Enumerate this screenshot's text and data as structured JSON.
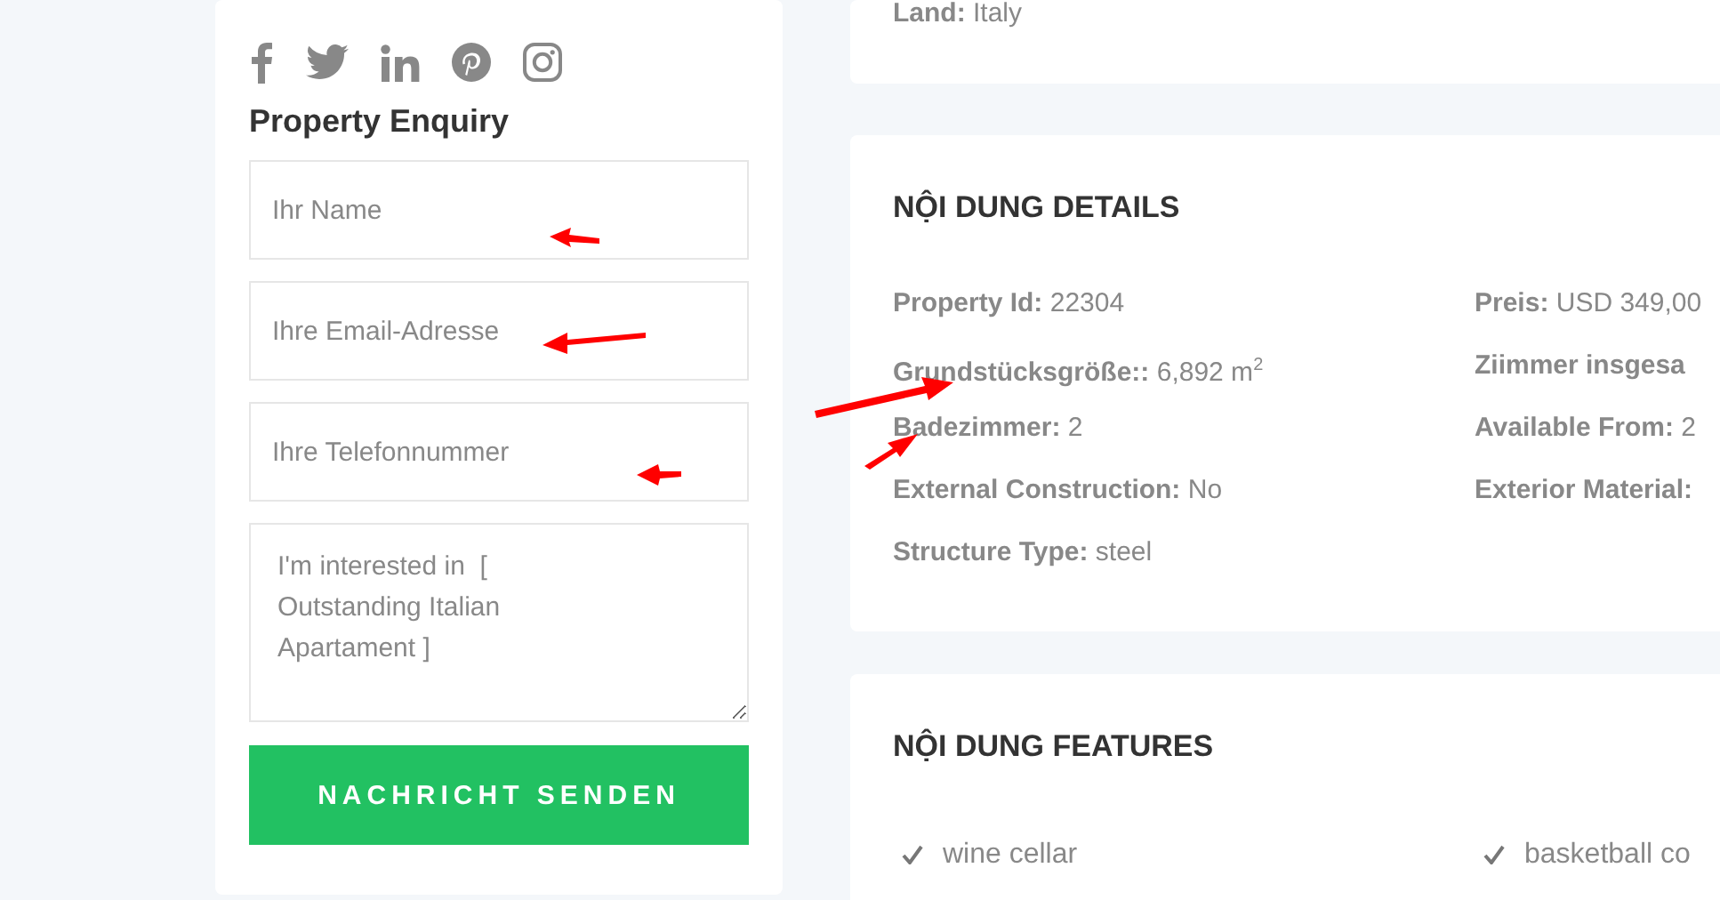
{
  "enquiry": {
    "title": "Property Enquiry",
    "fields": [
      {
        "kind": "input",
        "placeholder": "Ihr Name"
      },
      {
        "kind": "input",
        "placeholder": "Ihre Email-Adresse"
      },
      {
        "kind": "input",
        "placeholder": "Ihre Telefonnummer"
      },
      {
        "kind": "textarea",
        "value": "I'm interested in  [ Outstanding Italian Apartament ]"
      }
    ],
    "button": "NACHRICHT SENDEN"
  },
  "address": {
    "items": [
      {
        "label": "Land:",
        "value": "Italy"
      }
    ]
  },
  "details": {
    "title": "NỘI DUNG DETAILS",
    "columns": [
      [
        {
          "label": "Property Id:",
          "value": "22304"
        },
        {
          "label": "Grundstücksgröße::",
          "value": "6,892 m$^{2}$"
        },
        {
          "label": "Badezimmer:",
          "value": "2"
        },
        {
          "label": "External Construction:",
          "value": "No"
        },
        {
          "label": "Structure Type:",
          "value": "steel"
        }
      ],
      [
        {
          "label": "Preis:",
          "value": "USD 349,00"
        },
        {
          "label": "Ziimmer insgesa"
        },
        {
          "label": "Available From:",
          "value": "2"
        },
        {
          "label": "Exterior Material:"
        }
      ]
    ]
  },
  "features": {
    "title": "NỘI DUNG FEATURES",
    "columns": [
      [
        {
          "label": "wine cellar"
        }
      ],
      [
        {
          "label": "basketball co"
        }
      ]
    ]
  }
}
